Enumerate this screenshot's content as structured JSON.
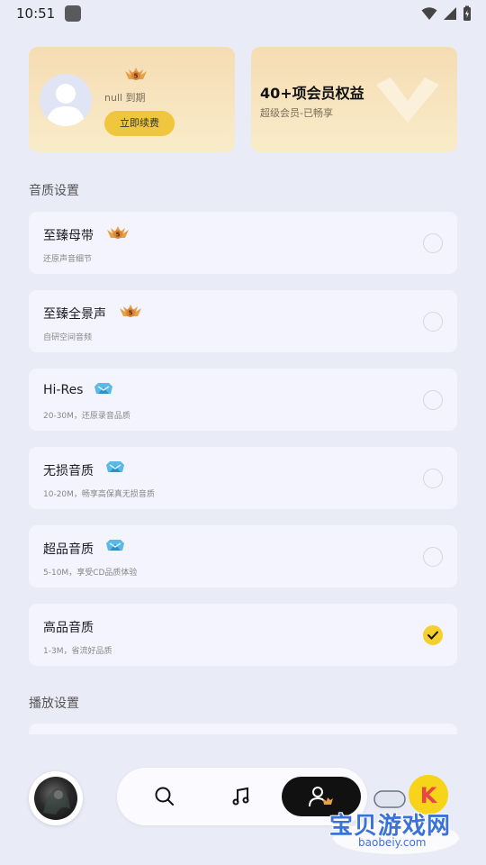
{
  "status_bar": {
    "time": "10:51"
  },
  "member_card": {
    "crown_level": "5",
    "expire_text": "null 到期",
    "renew_label": "立即续费"
  },
  "benefit_card": {
    "title": "40+项会员权益",
    "subtitle": "超级会员-已畅享"
  },
  "sections": {
    "audio_quality": "音质设置",
    "playback": "播放设置"
  },
  "audio_options": [
    {
      "title": "至臻母带",
      "desc": "还原声音细节",
      "badge": "crown-5-badge-icon",
      "selected": false
    },
    {
      "title": "至臻全景声",
      "desc": "自研空间音频",
      "badge": "crown-5-badge-icon",
      "selected": false
    },
    {
      "title": "Hi-Res",
      "desc": "20-30M，还原录音品质",
      "badge": "blue-diamond-badge-icon",
      "selected": false
    },
    {
      "title": "无损音质",
      "desc": "10-20M，畅享高保真无损音质",
      "badge": "blue-diamond-badge-icon",
      "selected": false
    },
    {
      "title": "超品音质",
      "desc": "5-10M，享受CD品质体验",
      "badge": "blue-diamond-badge-icon",
      "selected": false
    },
    {
      "title": "高品音质",
      "desc": "1-3M，省流好品质",
      "badge": "",
      "selected": true
    }
  ],
  "bottom_nav": {
    "tabs": [
      "search-icon",
      "music-note-icon",
      "profile-icon"
    ],
    "active": "profile-icon"
  },
  "watermark": {
    "text": "宝贝游戏网",
    "domain": "baobeiy.com"
  },
  "colors": {
    "background": "#e9ebf7",
    "card_gold": "#f6dcb3",
    "accent_yellow": "#f5cf2d",
    "option_bg": "#f3f4fd"
  }
}
